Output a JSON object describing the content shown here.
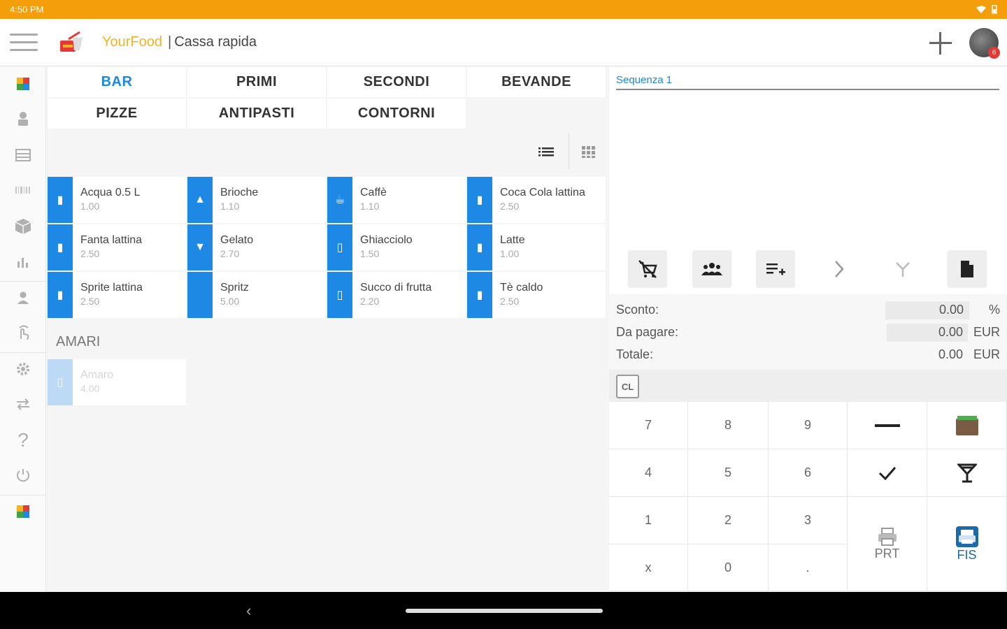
{
  "status_bar": {
    "time": "4:50 PM"
  },
  "app_bar": {
    "brand": "YourFood",
    "separator": "|",
    "title": "Cassa rapida",
    "notification_count": "6"
  },
  "rail": {
    "items": [
      "categories-icon",
      "account-icon",
      "table-icon",
      "barcode-icon",
      "package-icon",
      "chart-icon",
      "person-icon",
      "touch-icon",
      "gear-icon",
      "swap-icon",
      "help-icon",
      "power-icon",
      "brand-icon"
    ]
  },
  "categories": [
    {
      "label": "BAR",
      "active": true
    },
    {
      "label": "PRIMI"
    },
    {
      "label": "SECONDI"
    },
    {
      "label": "BEVANDE"
    },
    {
      "label": "PIZZE"
    },
    {
      "label": "ANTIPASTI"
    },
    {
      "label": "CONTORNI"
    }
  ],
  "products": [
    {
      "name": "Acqua 0.5 L",
      "price": "1.00",
      "icon": "bottle-icon"
    },
    {
      "name": "Brioche",
      "price": "1.10",
      "icon": "croissant-icon"
    },
    {
      "name": "Caffè",
      "price": "1.10",
      "icon": "coffee-icon"
    },
    {
      "name": "Coca Cola lattina",
      "price": "2.50",
      "icon": "can-icon"
    },
    {
      "name": "Fanta lattina",
      "price": "2.50",
      "icon": "can-icon"
    },
    {
      "name": "Gelato",
      "price": "2.70",
      "icon": "icecream-icon"
    },
    {
      "name": "Ghiacciolo",
      "price": "1.50",
      "icon": "popsicle-icon"
    },
    {
      "name": "Latte",
      "price": "1.00",
      "icon": "milk-icon"
    },
    {
      "name": "Sprite lattina",
      "price": "2.50",
      "icon": "can-icon"
    },
    {
      "name": "Spritz",
      "price": "5.00",
      "icon": ""
    },
    {
      "name": "Succo di frutta",
      "price": "2.20",
      "icon": "juice-icon"
    },
    {
      "name": "Tè caldo",
      "price": "2.50",
      "icon": "tea-icon"
    }
  ],
  "amari": {
    "label": "AMARI",
    "products": [
      {
        "name": "Amaro",
        "price": "4.00",
        "icon": "cup-icon"
      }
    ]
  },
  "order": {
    "sequence_tab": "Sequenza 1",
    "actions": [
      "remove-cart-icon",
      "group-icon",
      "playlist-add-icon",
      "chevron-right-icon",
      "split-icon",
      "document-icon"
    ],
    "totals": {
      "discount_label": "Sconto:",
      "discount_value": "0.00",
      "discount_unit": "%",
      "to_pay_label": "Da pagare:",
      "to_pay_value": "0.00",
      "to_pay_unit": "EUR",
      "total_label": "Totale:",
      "total_value": "0.00",
      "total_unit": "EUR"
    },
    "cl_label": "CL"
  },
  "keypad": {
    "keys": [
      "7",
      "8",
      "9",
      "4",
      "5",
      "6",
      "1",
      "2",
      "3",
      "x",
      "0",
      "."
    ],
    "prt_label": "PRT",
    "fis_label": "FIS"
  },
  "colors": {
    "accent": "#1e88e5",
    "status_bar": "#f59e0b",
    "brand": "#f5b324"
  }
}
